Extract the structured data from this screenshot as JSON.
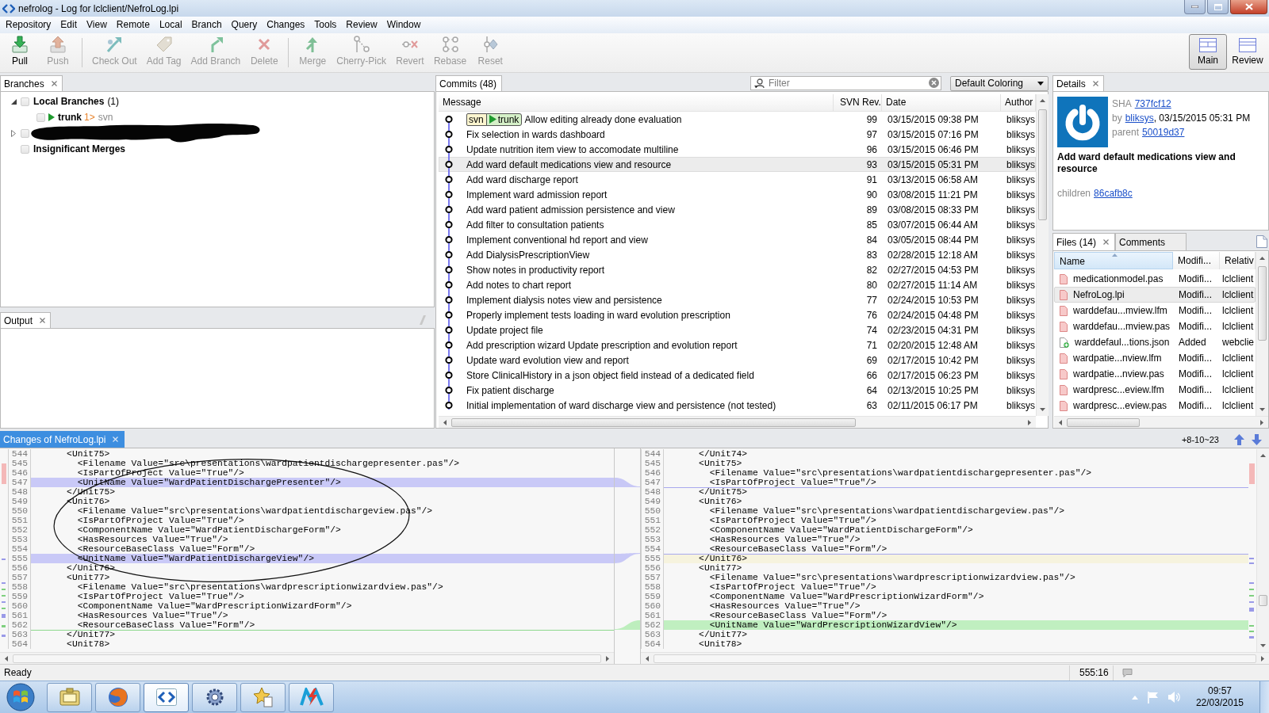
{
  "window": {
    "title": "nefrolog - Log for lclclient/NefroLog.lpi"
  },
  "menu": [
    "Repository",
    "Edit",
    "View",
    "Remote",
    "Local",
    "Branch",
    "Query",
    "Changes",
    "Tools",
    "Review",
    "Window"
  ],
  "toolbar": {
    "groups": [
      [
        {
          "label": "Pull",
          "disabled": false
        },
        {
          "label": "Push",
          "disabled": true
        }
      ],
      [
        {
          "label": "Check Out",
          "disabled": true
        },
        {
          "label": "Add Tag",
          "disabled": true
        },
        {
          "label": "Add Branch",
          "disabled": true
        },
        {
          "label": "Delete",
          "disabled": true
        }
      ],
      [
        {
          "label": "Merge",
          "disabled": true
        },
        {
          "label": "Cherry-Pick",
          "disabled": true
        },
        {
          "label": "Revert",
          "disabled": true
        },
        {
          "label": "Rebase",
          "disabled": true
        },
        {
          "label": "Reset",
          "disabled": true
        }
      ]
    ],
    "views": [
      {
        "label": "Main",
        "selected": true
      },
      {
        "label": "Review",
        "selected": false
      }
    ]
  },
  "branches_panel": {
    "tab": "Branches",
    "tree": [
      {
        "kind": "group",
        "label": "Local Branches",
        "count": "(1)",
        "checked": false,
        "expanded": true,
        "children": [
          {
            "kind": "branch",
            "label": "trunk",
            "ahead": "1>",
            "upstream": "svn",
            "checked": false,
            "current": true
          }
        ]
      },
      {
        "kind": "redacted",
        "checked": false,
        "expanded": false
      },
      {
        "kind": "option",
        "label": "Insignificant Merges",
        "checked": false
      }
    ]
  },
  "output_panel": {
    "tab": "Output"
  },
  "commits_panel": {
    "tab": "Commits (48)",
    "filter": {
      "placeholder": "Filter"
    },
    "coloring": "Default Coloring",
    "columns": [
      "Message",
      "SVN Rev.",
      "Date",
      "Author"
    ],
    "rows": [
      {
        "message": "Allow editing already done evaluation",
        "rev": "99",
        "date": "03/15/2015 09:38 PM",
        "author": "bliksys",
        "selected": false,
        "refs": [
          {
            "label": "svn",
            "kind": "remote"
          },
          {
            "label": "trunk",
            "kind": "local"
          }
        ]
      },
      {
        "message": "Fix selection in wards dashboard",
        "rev": "97",
        "date": "03/15/2015 07:16 PM",
        "author": "bliksys",
        "selected": false
      },
      {
        "message": "Update nutrition item view to accomodate multiline",
        "rev": "96",
        "date": "03/15/2015 06:46 PM",
        "author": "bliksys",
        "selected": false
      },
      {
        "message": "Add ward default medications view and resource",
        "rev": "93",
        "date": "03/15/2015 05:31 PM",
        "author": "bliksys",
        "selected": true
      },
      {
        "message": "Add ward discharge report",
        "rev": "91",
        "date": "03/13/2015 06:58 AM",
        "author": "bliksys",
        "selected": false
      },
      {
        "message": "Implement ward admission report",
        "rev": "90",
        "date": "03/08/2015 11:21 PM",
        "author": "bliksys",
        "selected": false
      },
      {
        "message": "Add ward patient admission persistence and view",
        "rev": "89",
        "date": "03/08/2015 08:33 PM",
        "author": "bliksys",
        "selected": false
      },
      {
        "message": "Add filter to consultation patients",
        "rev": "85",
        "date": "03/07/2015 06:44 AM",
        "author": "bliksys",
        "selected": false
      },
      {
        "message": "Implement conventional hd report and view",
        "rev": "84",
        "date": "03/05/2015 08:44 PM",
        "author": "bliksys",
        "selected": false
      },
      {
        "message": "Add DialysisPrescriptionView",
        "rev": "83",
        "date": "02/28/2015 12:18 AM",
        "author": "bliksys",
        "selected": false
      },
      {
        "message": "Show notes in productivity report",
        "rev": "82",
        "date": "02/27/2015 04:53 PM",
        "author": "bliksys",
        "selected": false
      },
      {
        "message": "Add notes to chart report",
        "rev": "80",
        "date": "02/27/2015 11:14 AM",
        "author": "bliksys",
        "selected": false
      },
      {
        "message": "Implement dialysis notes view and persistence",
        "rev": "77",
        "date": "02/24/2015 10:53 PM",
        "author": "bliksys",
        "selected": false
      },
      {
        "message": "Properly implement tests loading in ward evolution prescription",
        "rev": "76",
        "date": "02/24/2015 04:48 PM",
        "author": "bliksys",
        "selected": false
      },
      {
        "message": "Update project file",
        "rev": "74",
        "date": "02/23/2015 04:31 PM",
        "author": "bliksys",
        "selected": false
      },
      {
        "message": "Add prescription wizard Update prescription and evolution report",
        "rev": "71",
        "date": "02/20/2015 12:48 AM",
        "author": "bliksys",
        "selected": false
      },
      {
        "message": "Update ward evolution view and report",
        "rev": "69",
        "date": "02/17/2015 10:42 PM",
        "author": "bliksys",
        "selected": false
      },
      {
        "message": "Store ClinicalHistory in a json object field instead of a dedicated field",
        "rev": "66",
        "date": "02/17/2015 06:23 PM",
        "author": "bliksys",
        "selected": false
      },
      {
        "message": "Fix patient discharge",
        "rev": "64",
        "date": "02/13/2015 10:25 PM",
        "author": "bliksys",
        "selected": false
      },
      {
        "message": "Initial implementation of ward discharge view and persistence (not tested)",
        "rev": "63",
        "date": "02/11/2015 06:17 PM",
        "author": "bliksys",
        "selected": false
      }
    ]
  },
  "details_panel": {
    "tab": "Details",
    "sha_label": "SHA",
    "sha": "737fcf12",
    "by_label": "by",
    "author": "bliksys",
    "date": ", 03/15/2015 05:31 PM",
    "parent_label": "parent",
    "parent": "50019d37",
    "message": "Add ward default medications view and resource",
    "children_label": "children",
    "children": "86cafb8c"
  },
  "files_panel": {
    "tabs": [
      {
        "label": "Files (14)",
        "selected": true,
        "closable": true
      },
      {
        "label": "Comments",
        "selected": false,
        "closable": false
      }
    ],
    "columns": [
      {
        "label": "Name",
        "sorted": true
      },
      {
        "label": "Modifi...",
        "sorted": false
      },
      {
        "label": "Relativ",
        "sorted": false
      }
    ],
    "rows": [
      {
        "name": "medicationmodel.pas",
        "state": "Modifi...",
        "path": "lclclient",
        "kind": "modified",
        "selected": false
      },
      {
        "name": "NefroLog.lpi",
        "state": "Modifi...",
        "path": "lclclient",
        "kind": "modified",
        "selected": true
      },
      {
        "name": "warddefau...mview.lfm",
        "state": "Modifi...",
        "path": "lclclient",
        "kind": "modified",
        "selected": false
      },
      {
        "name": "warddefau...mview.pas",
        "state": "Modifi...",
        "path": "lclclient",
        "kind": "modified",
        "selected": false
      },
      {
        "name": "warddefaul...tions.json",
        "state": "Added",
        "path": "webclie",
        "kind": "added",
        "selected": false
      },
      {
        "name": "wardpatie...nview.lfm",
        "state": "Modifi...",
        "path": "lclclient",
        "kind": "modified",
        "selected": false
      },
      {
        "name": "wardpatie...nview.pas",
        "state": "Modifi...",
        "path": "lclclient",
        "kind": "modified",
        "selected": false
      },
      {
        "name": "wardpresc...eview.lfm",
        "state": "Modifi...",
        "path": "lclclient",
        "kind": "modified",
        "selected": false
      },
      {
        "name": "wardpresc...eview.pas",
        "state": "Modifi...",
        "path": "lclclient",
        "kind": "modified",
        "selected": false
      }
    ]
  },
  "changes_panel": {
    "tab": "Changes of NefroLog.lpi",
    "stats": "+8-10~23",
    "left": [
      {
        "kind": "plain",
        "number": "544",
        "text": "    <Unit75>"
      },
      {
        "kind": "plain",
        "number": "545",
        "text": "      <Filename Value=\"src\\presentations\\wardpatientdischargepresenter.pas\"/>"
      },
      {
        "kind": "plain",
        "number": "546",
        "text": "      <IsPartOfProject Value=\"True\"/>"
      },
      {
        "kind": "removed",
        "number": "547",
        "text": "      <UnitName Value=\"WardPatientDischargePresenter\"/>"
      },
      {
        "kind": "plain",
        "number": "548",
        "text": "    </Unit75>"
      },
      {
        "kind": "plain",
        "number": "549",
        "text": "    <Unit76>"
      },
      {
        "kind": "plain",
        "number": "550",
        "text": "      <Filename Value=\"src\\presentations\\wardpatientdischargeview.pas\"/>"
      },
      {
        "kind": "plain",
        "number": "551",
        "text": "      <IsPartOfProject Value=\"True\"/>"
      },
      {
        "kind": "plain",
        "number": "552",
        "text": "      <ComponentName Value=\"WardPatientDischargeForm\"/>"
      },
      {
        "kind": "plain",
        "number": "553",
        "text": "      <HasResources Value=\"True\"/>"
      },
      {
        "kind": "plain",
        "number": "554",
        "text": "      <ResourceBaseClass Value=\"Form\"/>"
      },
      {
        "kind": "removed",
        "number": "555",
        "text": "      <UnitName Value=\"WardPatientDischargeView\"/>"
      },
      {
        "kind": "plain",
        "number": "556",
        "text": "    </Unit76>"
      },
      {
        "kind": "plain",
        "number": "557",
        "text": "    <Unit77>"
      },
      {
        "kind": "plain",
        "number": "558",
        "text": "      <Filename Value=\"src\\presentations\\wardprescriptionwizardview.pas\"/>"
      },
      {
        "kind": "plain",
        "number": "559",
        "text": "      <IsPartOfProject Value=\"True\"/>"
      },
      {
        "kind": "plain",
        "number": "560",
        "text": "      <ComponentName Value=\"WardPrescriptionWizardForm\"/>"
      },
      {
        "kind": "plain",
        "number": "561",
        "text": "      <HasResources Value=\"True\"/>"
      },
      {
        "kind": "plain",
        "number": "562",
        "text": "      <ResourceBaseClass Value=\"Form\"/>"
      },
      {
        "kind": "gap"
      },
      {
        "kind": "plain",
        "number": "563",
        "text": "    </Unit77>"
      },
      {
        "kind": "plain",
        "number": "564",
        "text": "    <Unit78>"
      }
    ],
    "right": [
      {
        "kind": "plain",
        "number": "544",
        "text": "    </Unit74>"
      },
      {
        "kind": "plain",
        "number": "545",
        "text": "    <Unit75>"
      },
      {
        "kind": "plain",
        "number": "546",
        "text": "      <Filename Value=\"src\\presentations\\wardpatientdischargepresenter.pas\"/>"
      },
      {
        "kind": "plain",
        "number": "547",
        "text": "      <IsPartOfProject Value=\"True\"/>"
      },
      {
        "kind": "gap"
      },
      {
        "kind": "plain",
        "number": "548",
        "text": "    </Unit75>"
      },
      {
        "kind": "plain",
        "number": "549",
        "text": "    <Unit76>"
      },
      {
        "kind": "plain",
        "number": "550",
        "text": "      <Filename Value=\"src\\presentations\\wardpatientdischargeview.pas\"/>"
      },
      {
        "kind": "plain",
        "number": "551",
        "text": "      <IsPartOfProject Value=\"True\"/>"
      },
      {
        "kind": "plain",
        "number": "552",
        "text": "      <ComponentName Value=\"WardPatientDischargeForm\"/>"
      },
      {
        "kind": "plain",
        "number": "553",
        "text": "      <HasResources Value=\"True\"/>"
      },
      {
        "kind": "plain",
        "number": "554",
        "text": "      <ResourceBaseClass Value=\"Form\"/>"
      },
      {
        "kind": "gap"
      },
      {
        "kind": "current",
        "number": "555",
        "text": "    </Unit76>"
      },
      {
        "kind": "plain",
        "number": "556",
        "text": "    <Unit77>"
      },
      {
        "kind": "plain",
        "number": "557",
        "text": "      <Filename Value=\"src\\presentations\\wardprescriptionwizardview.pas\"/>"
      },
      {
        "kind": "plain",
        "number": "558",
        "text": "      <IsPartOfProject Value=\"True\"/>"
      },
      {
        "kind": "plain",
        "number": "559",
        "text": "      <ComponentName Value=\"WardPrescriptionWizardForm\"/>"
      },
      {
        "kind": "plain",
        "number": "560",
        "text": "      <HasResources Value=\"True\"/>"
      },
      {
        "kind": "plain",
        "number": "561",
        "text": "      <ResourceBaseClass Value=\"Form\"/>"
      },
      {
        "kind": "added",
        "number": "562",
        "text": "      <UnitName Value=\"WardPrescriptionWizardView\"/>"
      },
      {
        "kind": "plain",
        "number": "563",
        "text": "    </Unit77>"
      },
      {
        "kind": "plain",
        "number": "564",
        "text": "    <Unit78>"
      }
    ]
  },
  "status_bar": {
    "message": "Ready",
    "position": "555:16"
  },
  "taskbar": {
    "apps": [
      {
        "selected": false
      },
      {
        "selected": false
      },
      {
        "selected": true
      },
      {
        "selected": false
      },
      {
        "selected": false
      },
      {
        "selected": false
      }
    ],
    "time": "09:57",
    "date": "22/03/2015"
  }
}
